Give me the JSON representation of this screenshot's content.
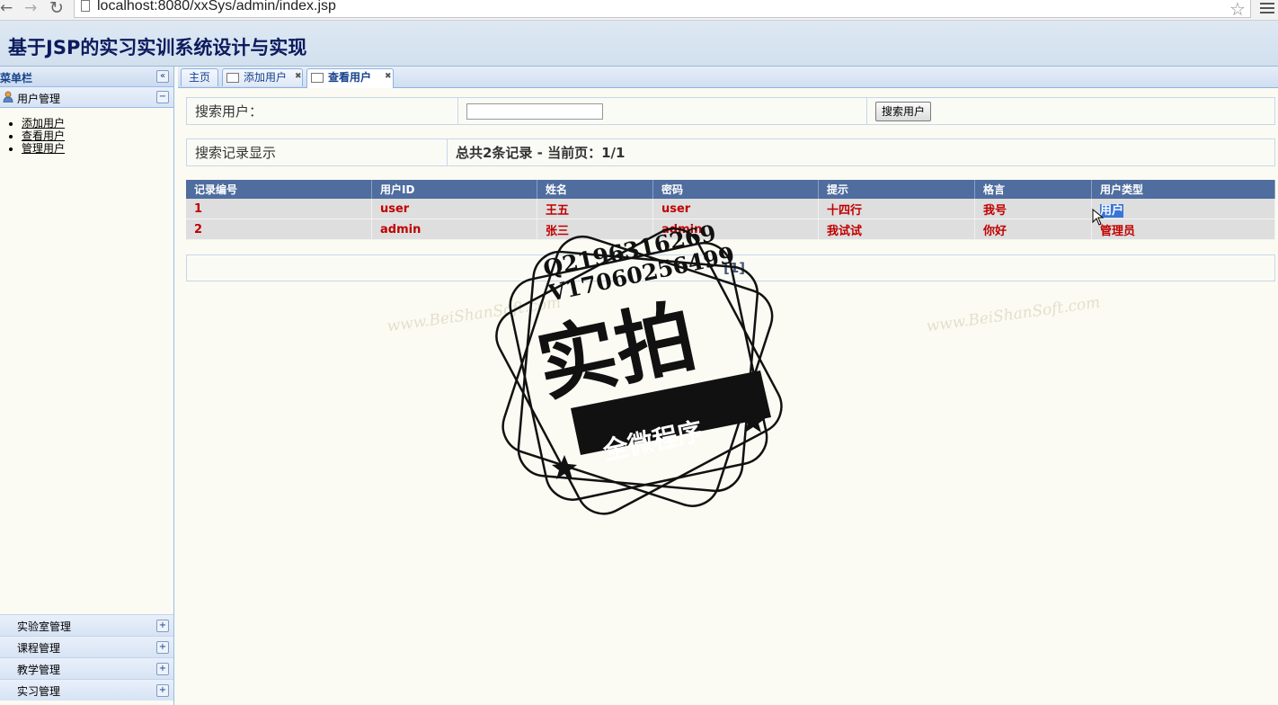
{
  "browser": {
    "url": "localhost:8080/xxSys/admin/index.jsp"
  },
  "header": {
    "title": "基于JSP的实习实训系统设计与实现"
  },
  "sidebar": {
    "title": "菜单栏",
    "open_section": {
      "label": "用户管理",
      "links": [
        "添加用户",
        "查看用户",
        "管理用户"
      ]
    },
    "sections": [
      "实验室管理",
      "课程管理",
      "教学管理",
      "实习管理"
    ]
  },
  "tabs": [
    {
      "label": "主页"
    },
    {
      "label": "添加用户"
    },
    {
      "label": "查看用户"
    }
  ],
  "search": {
    "label": "搜索用户：",
    "input_value": "",
    "button_label": "搜索用户"
  },
  "summary": {
    "label": "搜索记录显示",
    "text": "总共2条记录 - 当前页：1/1"
  },
  "table": {
    "columns": [
      "记录编号",
      "用户ID",
      "姓名",
      "密码",
      "提示",
      "格言",
      "用户类型"
    ],
    "rows": [
      [
        "1",
        "user",
        "王五",
        "user",
        "十四行",
        "我号",
        "用户"
      ],
      [
        "2",
        "admin",
        "张三",
        "admin",
        "我试试",
        "你好",
        "管理员"
      ]
    ]
  },
  "pager": {
    "link": "[1]"
  },
  "watermark": {
    "lines": [
      "Q2196316269",
      "V17060256499"
    ],
    "main": "实拍",
    "banner": "全微程序",
    "bg_text": "www.BeiShanSoft.com"
  }
}
